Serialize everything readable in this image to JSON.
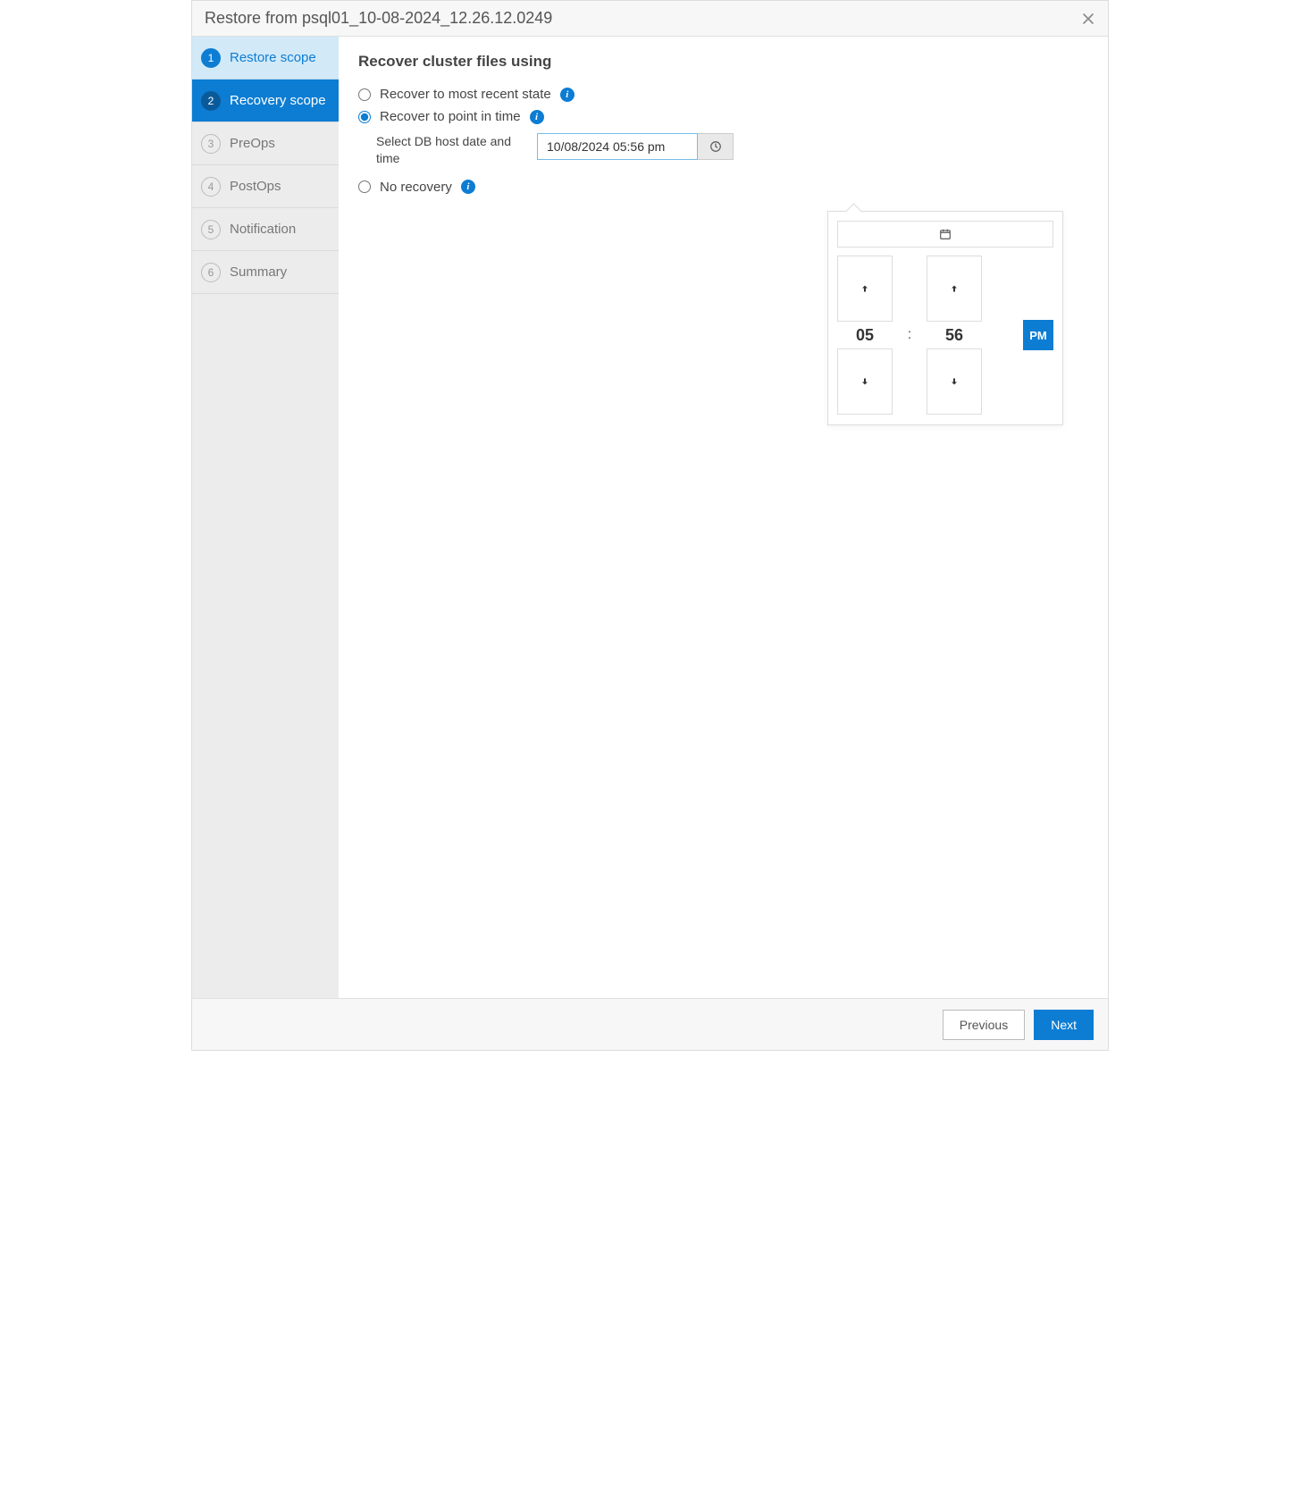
{
  "title": "Restore from psql01_10-08-2024_12.26.12.0249",
  "steps": [
    {
      "num": "1",
      "label": "Restore scope"
    },
    {
      "num": "2",
      "label": "Recovery scope"
    },
    {
      "num": "3",
      "label": "PreOps"
    },
    {
      "num": "4",
      "label": "PostOps"
    },
    {
      "num": "5",
      "label": "Notification"
    },
    {
      "num": "6",
      "label": "Summary"
    }
  ],
  "heading": "Recover cluster files using",
  "options": {
    "recent": "Recover to most recent state",
    "pit": "Recover to point in time",
    "none": "No recovery"
  },
  "pit_label": "Select DB host date and time",
  "datetime_value": "10/08/2024 05:56 pm",
  "picker": {
    "hour": "05",
    "minute": "56",
    "ampm": "PM",
    "colon": ":"
  },
  "footer": {
    "previous": "Previous",
    "next": "Next"
  }
}
